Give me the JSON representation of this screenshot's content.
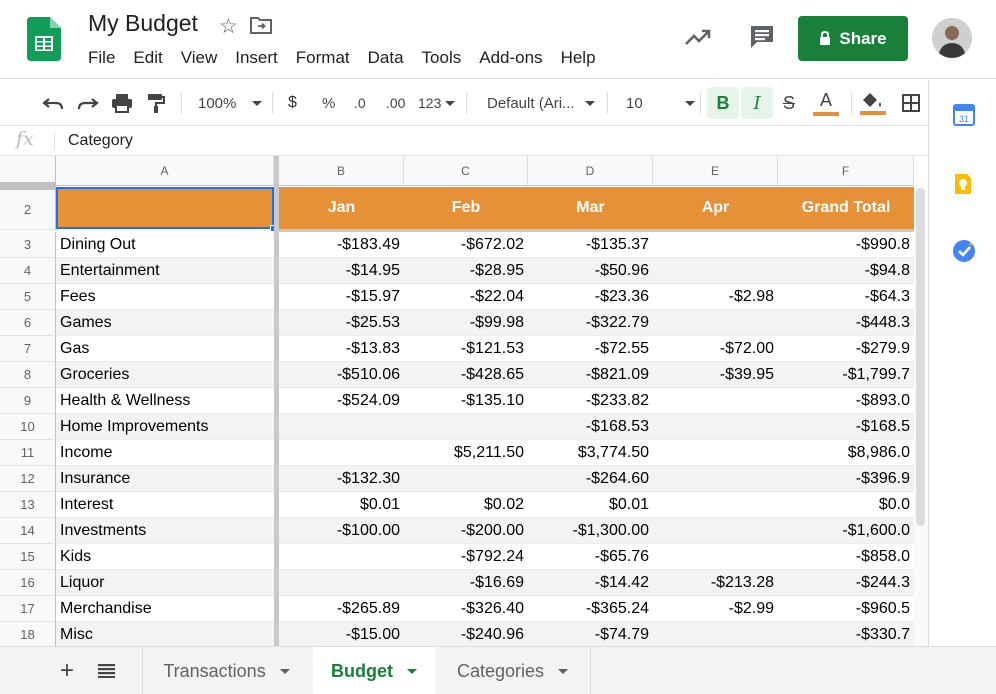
{
  "doc": {
    "title": "My Budget"
  },
  "menu": [
    "File",
    "Edit",
    "View",
    "Insert",
    "Format",
    "Data",
    "Tools",
    "Add-ons",
    "Help"
  ],
  "share_label": "Share",
  "toolbar": {
    "zoom": "100%",
    "currency": "$",
    "percent": "%",
    "dec_less": ".0",
    "dec_more": ".00",
    "more_formats": "123",
    "font": "Default (Ari...",
    "font_size": "10",
    "bold": "B",
    "italic": "I",
    "strike": "S",
    "text_color": "A"
  },
  "formula": {
    "fx": "fx",
    "value": "Category"
  },
  "columns": [
    "A",
    "B",
    "C",
    "D",
    "E",
    "F"
  ],
  "header_row": {
    "num": "2",
    "cells": [
      "",
      "Jan",
      "Feb",
      "Mar",
      "Apr",
      "Grand Total"
    ]
  },
  "rows": [
    {
      "num": "3",
      "category": "Dining Out",
      "jan": "-$183.49",
      "feb": "-$672.02",
      "mar": "-$135.37",
      "apr": "",
      "total": "-$990.8"
    },
    {
      "num": "4",
      "category": "Entertainment",
      "jan": "-$14.95",
      "feb": "-$28.95",
      "mar": "-$50.96",
      "apr": "",
      "total": "-$94.8"
    },
    {
      "num": "5",
      "category": "Fees",
      "jan": "-$15.97",
      "feb": "-$22.04",
      "mar": "-$23.36",
      "apr": "-$2.98",
      "total": "-$64.3"
    },
    {
      "num": "6",
      "category": "Games",
      "jan": "-$25.53",
      "feb": "-$99.98",
      "mar": "-$322.79",
      "apr": "",
      "total": "-$448.3"
    },
    {
      "num": "7",
      "category": "Gas",
      "jan": "-$13.83",
      "feb": "-$121.53",
      "mar": "-$72.55",
      "apr": "-$72.00",
      "total": "-$279.9"
    },
    {
      "num": "8",
      "category": "Groceries",
      "jan": "-$510.06",
      "feb": "-$428.65",
      "mar": "-$821.09",
      "apr": "-$39.95",
      "total": "-$1,799.7"
    },
    {
      "num": "9",
      "category": "Health & Wellness",
      "jan": "-$524.09",
      "feb": "-$135.10",
      "mar": "-$233.82",
      "apr": "",
      "total": "-$893.0"
    },
    {
      "num": "10",
      "category": "Home Improvements",
      "jan": "",
      "feb": "",
      "mar": "-$168.53",
      "apr": "",
      "total": "-$168.5"
    },
    {
      "num": "11",
      "category": "Income",
      "jan": "",
      "feb": "$5,211.50",
      "mar": "$3,774.50",
      "apr": "",
      "total": "$8,986.0"
    },
    {
      "num": "12",
      "category": "Insurance",
      "jan": "-$132.30",
      "feb": "",
      "mar": "-$264.60",
      "apr": "",
      "total": "-$396.9"
    },
    {
      "num": "13",
      "category": "Interest",
      "jan": "$0.01",
      "feb": "$0.02",
      "mar": "$0.01",
      "apr": "",
      "total": "$0.0"
    },
    {
      "num": "14",
      "category": "Investments",
      "jan": "-$100.00",
      "feb": "-$200.00",
      "mar": "-$1,300.00",
      "apr": "",
      "total": "-$1,600.0"
    },
    {
      "num": "15",
      "category": "Kids",
      "jan": "",
      "feb": "-$792.24",
      "mar": "-$65.76",
      "apr": "",
      "total": "-$858.0"
    },
    {
      "num": "16",
      "category": "Liquor",
      "jan": "",
      "feb": "-$16.69",
      "mar": "-$14.42",
      "apr": "-$213.28",
      "total": "-$244.3"
    },
    {
      "num": "17",
      "category": "Merchandise",
      "jan": "-$265.89",
      "feb": "-$326.40",
      "mar": "-$365.24",
      "apr": "-$2.99",
      "total": "-$960.5"
    },
    {
      "num": "18",
      "category": "Misc",
      "jan": "-$15.00",
      "feb": "-$240.96",
      "mar": "-$74.79",
      "apr": "",
      "total": "-$330.7"
    }
  ],
  "sheets": [
    {
      "label": "Transactions",
      "active": false
    },
    {
      "label": "Budget",
      "active": true
    },
    {
      "label": "Categories",
      "active": false
    }
  ],
  "colors": {
    "header_fill": "#e69138",
    "share_green": "#188038",
    "active_tab": "#188038"
  }
}
